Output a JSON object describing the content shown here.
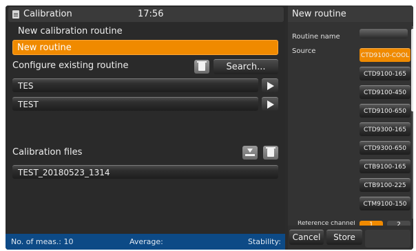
{
  "header": {
    "title": "Calibration",
    "time": "17:56"
  },
  "new_routine": {
    "label": "New calibration routine",
    "value": "New routine"
  },
  "configure": {
    "label": "Configure existing routine",
    "search_label": "Search...",
    "routines": [
      "TES",
      "TEST"
    ]
  },
  "calibration_files": {
    "label": "Calibration files",
    "files": [
      "TEST_20180523_1314"
    ]
  },
  "status": {
    "meas": "No. of meas.: 10",
    "average": "Average:",
    "stability": "Stability:"
  },
  "right_panel": {
    "title": "New routine",
    "routine_name_label": "Routine name",
    "source_label": "Source",
    "sources": [
      "CTD9100-COOL",
      "CTD9100-165",
      "CTD9100-450",
      "CTD9100-650",
      "CTD9300-165",
      "CTD9300-650",
      "CTB9100-165",
      "CTB9100-225",
      "CTM9100-150"
    ],
    "selected_source": "CTD9100-COOL",
    "reference_channel_label": "Reference channel",
    "reference_channels": [
      "1",
      "2"
    ],
    "cancel_label": "Cancel",
    "store_label": "Store"
  },
  "colors": {
    "accent": "#f08a00",
    "status_bar": "#0d4a86",
    "background": "#2b2b2b"
  }
}
